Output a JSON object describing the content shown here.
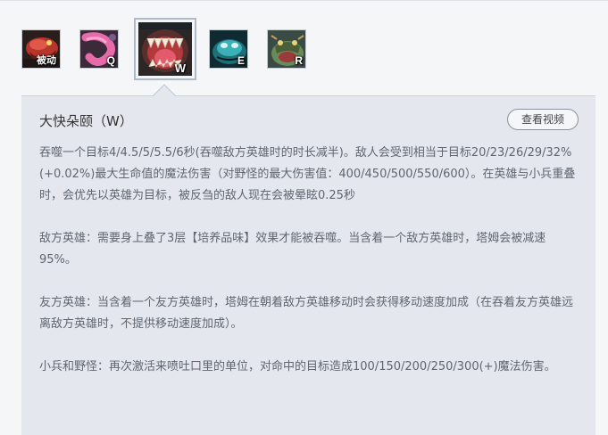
{
  "skills": [
    {
      "key": "被动",
      "icon": "passive-skill-icon"
    },
    {
      "key": "Q",
      "icon": "q-tongue-lash-icon"
    },
    {
      "key": "W",
      "icon": "w-devour-icon",
      "selected": true
    },
    {
      "key": "E",
      "icon": "e-thick-skin-icon"
    },
    {
      "key": "R",
      "icon": "r-regurgitate-icon"
    }
  ],
  "panel": {
    "title": "大快朵颐（W）",
    "video_button": "查看视频",
    "paragraphs": [
      "吞噬一个目标4/4.5/5/5.5/6秒(吞噬敌方英雄时的时长减半)。敌人会受到相当于目标20/23/26/29/32%(+0.02%)最大生命值的魔法伤害（对野怪的最大伤害值：400/450/500/550/600）。在英雄与小兵重叠时，会优先以英雄为目标，被反刍的敌人现在会被晕眩0.25秒",
      "敌方英雄：需要身上叠了3层【培养品味】效果才能被吞噬。当含着一个敌方英雄时，塔姆会被减速95%。",
      "友方英雄：当含着一个友方英雄时，塔姆在朝着敌方英雄移动时会获得移动速度加成（在吞着友方英雄远离敌方英雄时，不提供移动速度加成）。",
      "小兵和野怪：再次激活来喷吐口里的单位，对命中的目标造成100/150/200/250/300(+)魔法伤害。"
    ]
  },
  "colors": {
    "panel_bg": "#e4e8ee",
    "page_bg": "#f5f6f8",
    "text": "#5f6670",
    "title": "#333333"
  }
}
